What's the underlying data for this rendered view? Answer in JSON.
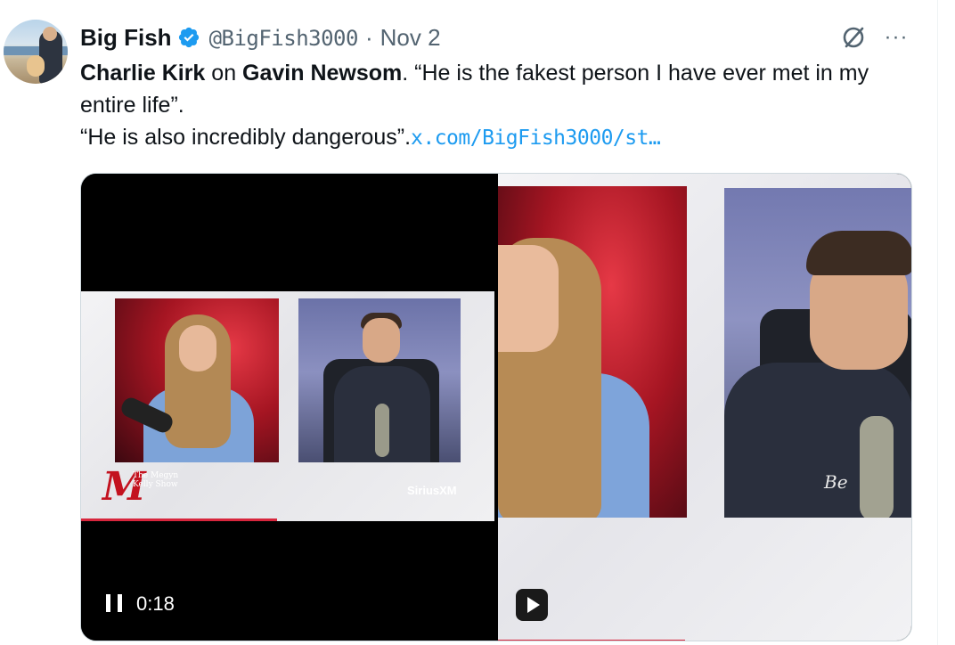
{
  "tweet": {
    "display_name": "Big Fish",
    "handle": "@BigFish3000",
    "separator": "·",
    "date": "Nov 2",
    "more_label": "···",
    "text": {
      "name1": "Charlie Kirk",
      "connector": " on ",
      "name2": "Gavin Newsom",
      "quote1": ". “He is the fakest person I have ever met in my entire life”.",
      "quote2": "“He is also incredibly dangerous”.",
      "link": "x.com/BigFish3000/st…"
    }
  },
  "media": {
    "left_video": {
      "elapsed": "0:18",
      "state": "playing",
      "show_logo_letter": "M",
      "show_logo_text": "The Megyn Kelly Show",
      "network": "SiriusXM"
    },
    "right_video": {
      "state": "paused",
      "shirt_text": "Be"
    }
  },
  "colors": {
    "link": "#1d9bf0",
    "verified": "#1d9bf0",
    "muted": "#536471",
    "accent_red": "#d7263d"
  },
  "icons": {
    "verified": "verified-badge-icon",
    "grok": "grok-icon",
    "more": "more-icon",
    "pause": "pause-icon",
    "play": "play-icon"
  }
}
